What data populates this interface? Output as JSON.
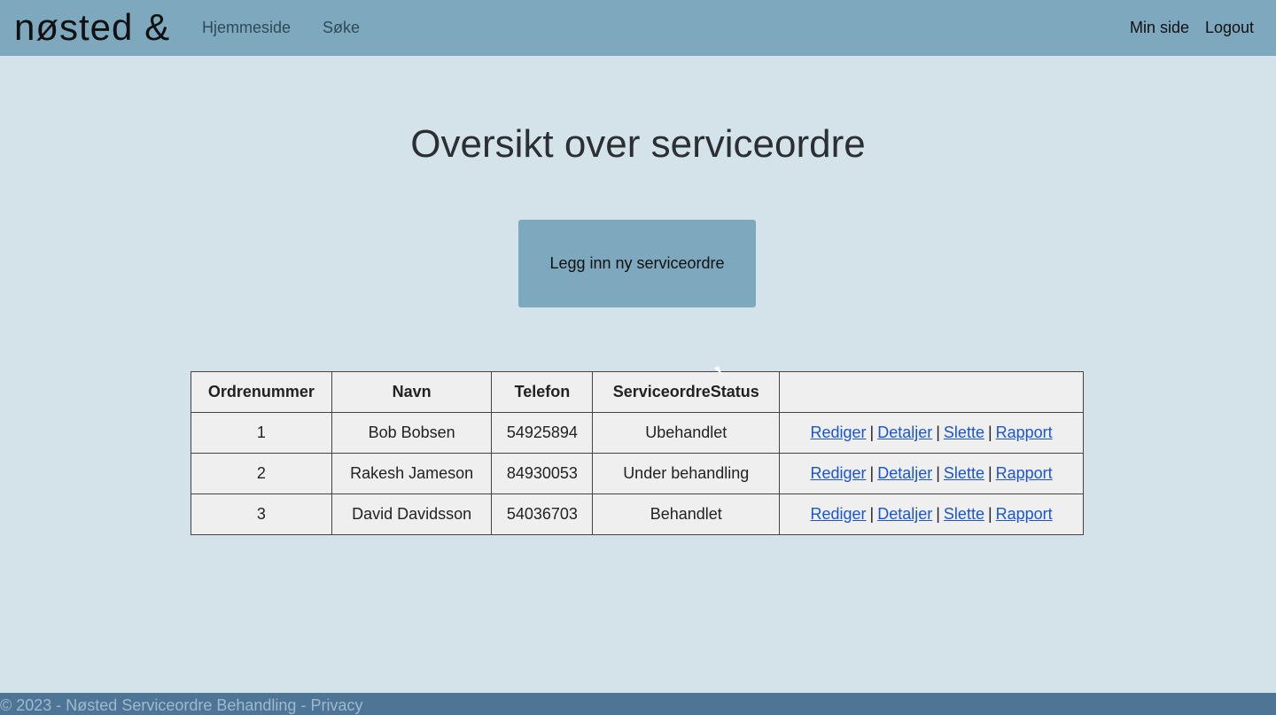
{
  "navbar": {
    "logo": "nøsted &",
    "links": [
      "Hjemmeside",
      "Søke"
    ],
    "right_links": [
      "Min side",
      "Logout"
    ]
  },
  "main": {
    "title": "Oversikt over serviceordre",
    "new_button_label": "Legg inn ny serviceordre"
  },
  "table": {
    "headers": [
      "Ordrenummer",
      "Navn",
      "Telefon",
      "ServiceordreStatus",
      ""
    ],
    "rows": [
      {
        "ordrenummer": "1",
        "navn": "Bob Bobsen",
        "telefon": "54925894",
        "status": "Ubehandlet"
      },
      {
        "ordrenummer": "2",
        "navn": "Rakesh Jameson",
        "telefon": "84930053",
        "status": "Under behandling"
      },
      {
        "ordrenummer": "3",
        "navn": "David Davidsson",
        "telefon": "54036703",
        "status": "Behandlet"
      }
    ],
    "actions": [
      "Rediger",
      "Detaljer",
      "Slette",
      "Rapport"
    ],
    "separator": "|"
  },
  "footer": {
    "text": "© 2023 - Nøsted Serviceordre Behandling - ",
    "privacy_link": "Privacy"
  },
  "colors": {
    "background": "#d4e3ea",
    "navbar": "#7ea8be",
    "footer": "#4e7595",
    "link": "#1a56c9"
  }
}
